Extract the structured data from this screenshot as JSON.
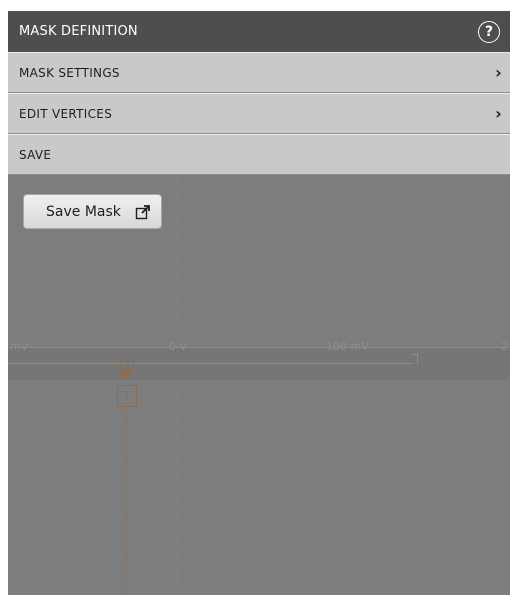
{
  "header": {
    "title": "MASK DEFINITION",
    "help_icon": "?"
  },
  "menu": {
    "items": [
      {
        "label": "MASK SETTINGS",
        "chevron": "›"
      },
      {
        "label": "EDIT VERTICES",
        "chevron": "›"
      },
      {
        "label": "SAVE"
      }
    ]
  },
  "save_section": {
    "button_label": "Save Mask",
    "button_icon": "external-link-icon"
  },
  "scope": {
    "axis_labels": [
      "mV",
      "0 V",
      "100 mV",
      "2"
    ],
    "trigger_small": "T",
    "trigger_marker": "T"
  },
  "colors": {
    "header_bg": "#4e4e4e",
    "row_bg": "#c9c9c9",
    "panel_bg": "#7d7d7d",
    "trigger": "#8a6e53"
  }
}
